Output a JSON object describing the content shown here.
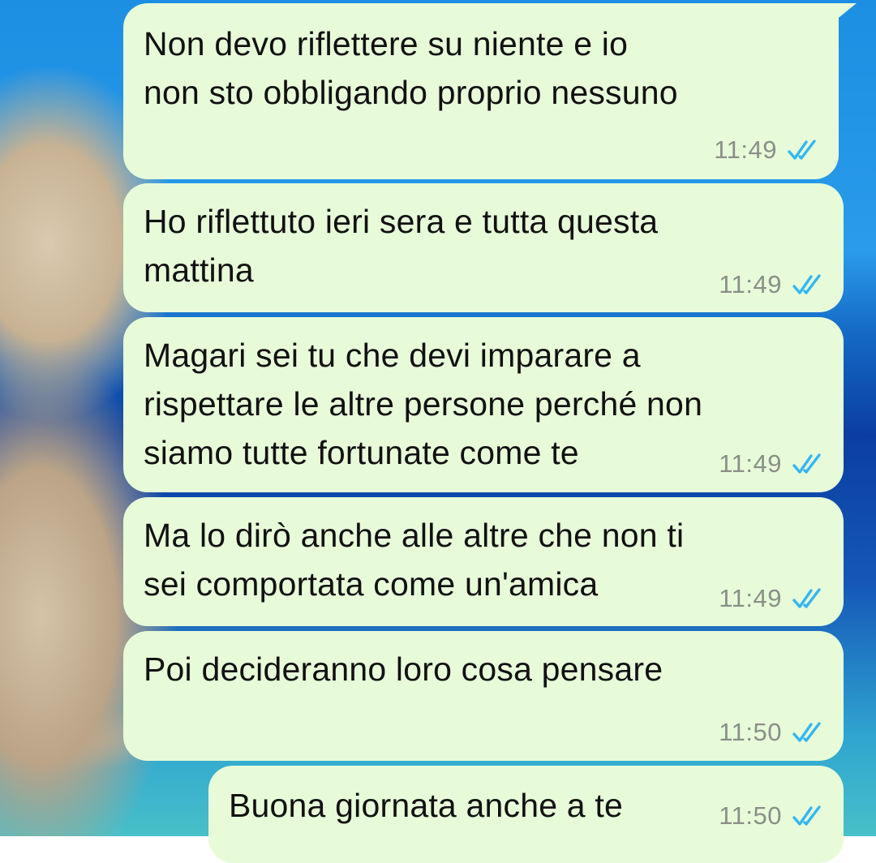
{
  "conversation": {
    "messages": [
      {
        "lines": [
          "Non devo riflettere su niente e io",
          "non sto obbligando proprio nessuno"
        ],
        "time": "11:49",
        "status_icon": "double-check-read-icon"
      },
      {
        "lines": [
          "Ho riflettuto ieri sera e tutta questa",
          "mattina"
        ],
        "time": "11:49",
        "status_icon": "double-check-read-icon"
      },
      {
        "lines": [
          "Magari sei tu che devi imparare a",
          "rispettare le altre persone perché non",
          "siamo tutte fortunate come te"
        ],
        "time": "11:49",
        "status_icon": "double-check-read-icon"
      },
      {
        "lines": [
          "Ma lo dirò anche alle altre che non ti",
          "sei comportata come un'amica"
        ],
        "time": "11:49",
        "status_icon": "double-check-read-icon"
      },
      {
        "lines": [
          "Poi decideranno loro cosa pensare"
        ],
        "time": "11:50",
        "status_icon": "double-check-read-icon"
      },
      {
        "lines": [
          "Buona giornata anche a te"
        ],
        "time": "11:50",
        "status_icon": "double-check-read-icon"
      }
    ]
  },
  "colors": {
    "outgoing_bubble": "#e7fbd9",
    "read_ticks": "#34b7f1",
    "time_text": "#8a8f87"
  }
}
